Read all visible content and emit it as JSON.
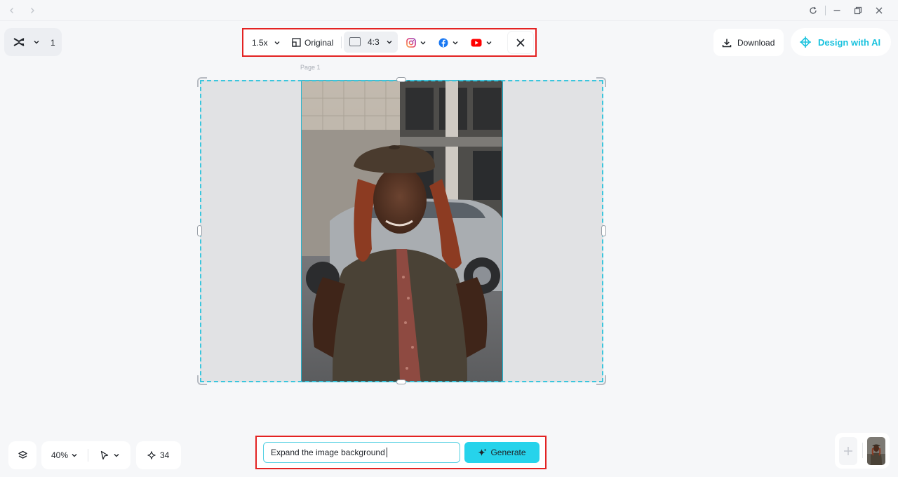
{
  "window": {
    "nav_back_icon": "chevron-left-icon",
    "nav_forward_icon": "chevron-right-icon",
    "controls": [
      "refresh-icon",
      "minimize-icon",
      "restore-icon",
      "close-icon"
    ]
  },
  "project": {
    "logo_icon": "capcut-logo-icon",
    "page_count": "1"
  },
  "toolbar": {
    "scale_label": "1.5x",
    "original_label": "Original",
    "ratio_label": "4:3",
    "social_icons": [
      "instagram-icon",
      "facebook-icon",
      "youtube-icon"
    ]
  },
  "header_actions": {
    "download_label": "Download",
    "design_ai_label": "Design with AI"
  },
  "canvas": {
    "page_label": "Page 1"
  },
  "bottom_left": {
    "zoom_label": "40%",
    "credits_label": "34"
  },
  "prompt": {
    "input_value": "Expand the image background",
    "generate_label": "Generate"
  },
  "colors": {
    "accent": "#19c2de",
    "generate": "#26d3eb",
    "highlight_frame": "#e32222"
  }
}
